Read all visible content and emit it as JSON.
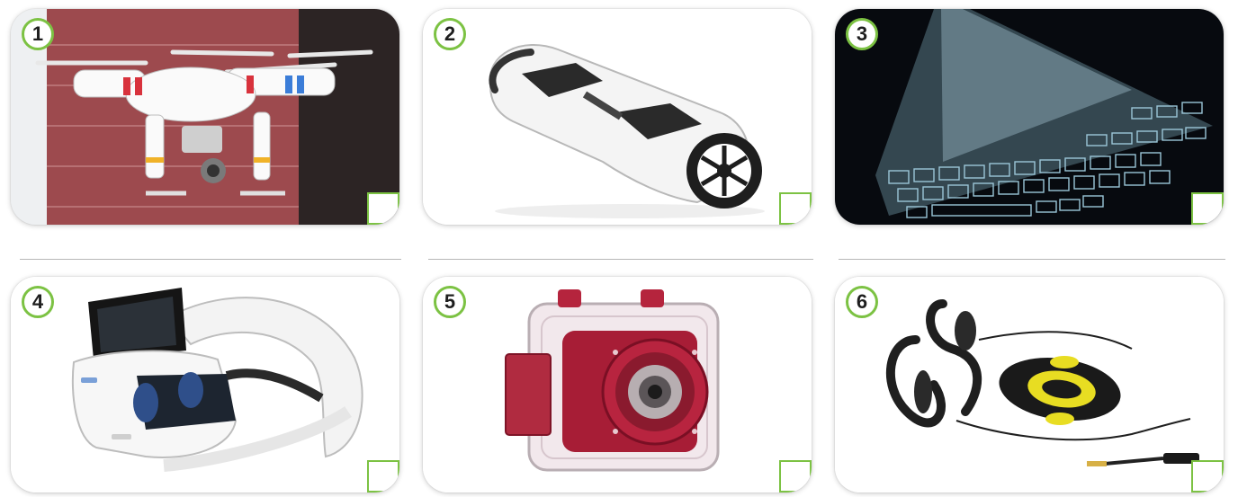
{
  "items": [
    {
      "number": "1",
      "icon": "drone-image",
      "checked": false
    },
    {
      "number": "2",
      "icon": "hoverboard-image",
      "checked": false
    },
    {
      "number": "3",
      "icon": "projection-keyboard-image",
      "checked": false
    },
    {
      "number": "4",
      "icon": "vr-headset-image",
      "checked": false
    },
    {
      "number": "5",
      "icon": "waterproof-camera-image",
      "checked": false
    },
    {
      "number": "6",
      "icon": "waterproof-headphones-image",
      "checked": false
    }
  ],
  "colors": {
    "accent": "#7cc243",
    "card_border": "#d9d9d9",
    "divider": "#b7b7b7"
  }
}
